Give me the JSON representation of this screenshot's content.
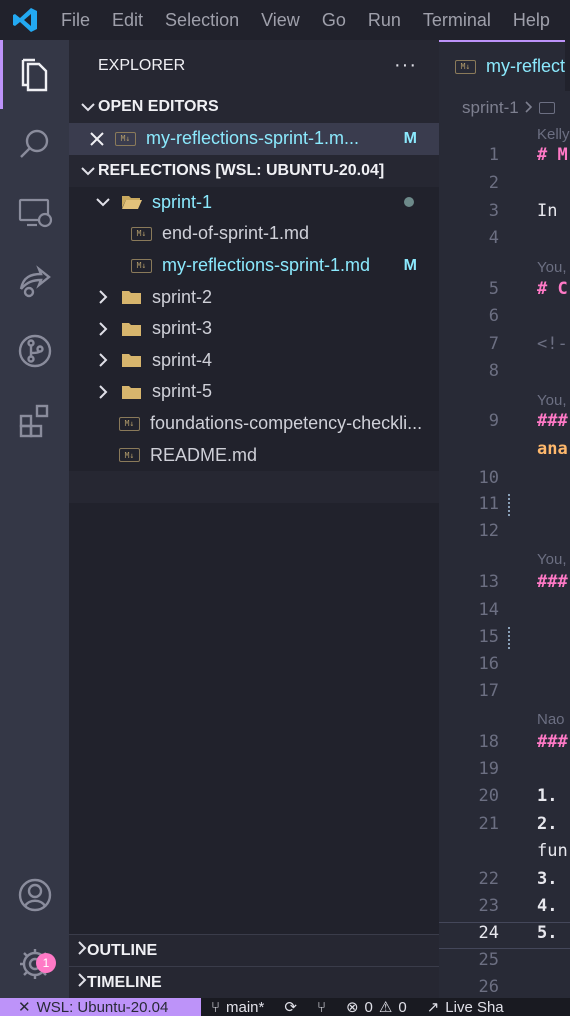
{
  "menu": [
    "File",
    "Edit",
    "Selection",
    "View",
    "Go",
    "Run",
    "Terminal",
    "Help"
  ],
  "colors": {
    "accent": "#bd93f9",
    "modified": "#8be9fd",
    "heading": "#ff79c6",
    "bold_text": "#ffb86c",
    "badge": "#ff79c6",
    "logo": "#23a9f2"
  },
  "activity": {
    "icons": [
      "explorer-icon",
      "search-icon",
      "remote-explorer-icon",
      "live-share-icon",
      "source-control-icon",
      "extensions-icon",
      "accounts-icon",
      "settings-gear-icon"
    ],
    "settings_badge": "1"
  },
  "sidebar": {
    "title": "EXPLORER",
    "more": "···",
    "open_editors": {
      "title": "OPEN EDITORS",
      "items": [
        {
          "name": "my-reflections-sprint-1.m...",
          "badge": "M"
        }
      ]
    },
    "workspace": {
      "title": "REFLECTIONS [WSL: UBUNTU-20.04]",
      "folder_open": "sprint-1",
      "children": [
        {
          "name": "end-of-sprint-1.md",
          "badge": ""
        },
        {
          "name": "my-reflections-sprint-1.md",
          "badge": "M"
        }
      ],
      "folders": [
        "sprint-2",
        "sprint-3",
        "sprint-4",
        "sprint-5"
      ],
      "files": [
        "foundations-competency-checkli...",
        "README.md"
      ]
    },
    "outline": "OUTLINE",
    "timeline": "TIMELINE"
  },
  "editor": {
    "tab": "my-reflect",
    "breadcrumb": "sprint-1",
    "line_numbers": [
      "1",
      "2",
      "3",
      "4",
      "5",
      "6",
      "7",
      "8",
      "9",
      "10",
      "11",
      "12",
      "13",
      "14",
      "15",
      "16",
      "17",
      "18",
      "19",
      "20",
      "21",
      "22",
      "23",
      "24",
      "25",
      "26"
    ],
    "current_line": "24",
    "hints": [
      "Kelly",
      "You,",
      "You,",
      "You,",
      "Nao"
    ],
    "code": {
      "l1": "# M",
      "l3": "In ",
      "l5": "# C",
      "l7": "<!-",
      "l9": "###",
      "l9b": "ana",
      "l13": "###",
      "l18": "###",
      "l20": "1.",
      "l21": "2.",
      "l21b": "fun",
      "l22": "3.",
      "l23": "4.",
      "l24": "5."
    }
  },
  "status": {
    "remote": "WSL: Ubuntu-20.04",
    "branch": "main*",
    "errors": "0",
    "warnings": "0",
    "live_share": "Live Sha"
  }
}
